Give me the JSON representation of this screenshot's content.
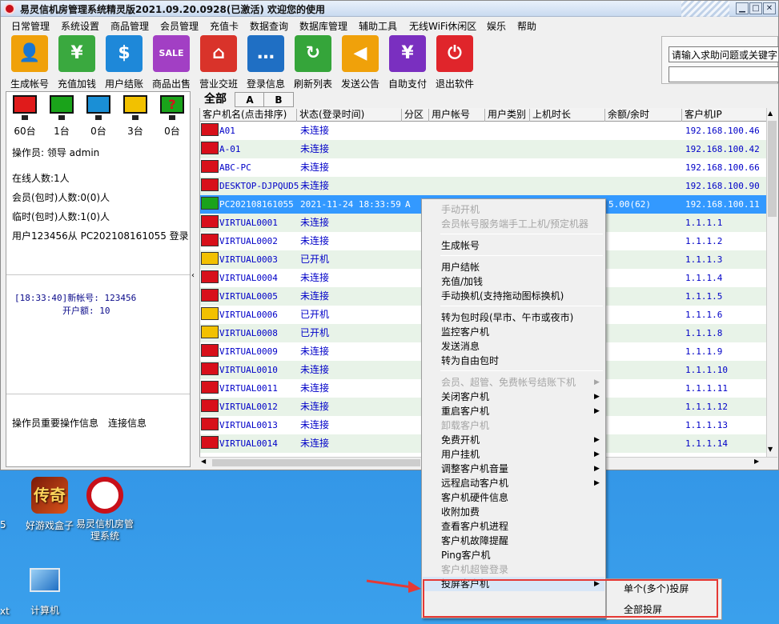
{
  "window": {
    "title": "易灵信机房管理系统精灵版2021.09.20.0928(已激活)   欢迎您的使用"
  },
  "menubar": [
    "日常管理",
    "系统设置",
    "商品管理",
    "会员管理",
    "充值卡",
    "数据查询",
    "数据库管理",
    "辅助工具",
    "无线WiFi休闲区",
    "娱乐",
    "帮助"
  ],
  "toolbar": [
    {
      "label": "生成帐号",
      "icon": "user-icon",
      "color": "#f0a10a",
      "glyph": "👤"
    },
    {
      "label": "充值加钱",
      "icon": "piggy-bank-icon",
      "color": "#3aa93f",
      "glyph": "¥"
    },
    {
      "label": "用户结账",
      "icon": "bill-icon",
      "color": "#1e88d9",
      "glyph": "$"
    },
    {
      "label": "商品出售",
      "icon": "sale-tag-icon",
      "color": "#a23fc4",
      "glyph": "SALE"
    },
    {
      "label": "营业交班",
      "icon": "shop-icon",
      "color": "#d9332a",
      "glyph": "⌂"
    },
    {
      "label": "登录信息",
      "icon": "chat-icon",
      "color": "#1f6fc4",
      "glyph": "…"
    },
    {
      "label": "刷新列表",
      "icon": "refresh-icon",
      "color": "#35a53a",
      "glyph": "↻"
    },
    {
      "label": "发送公告",
      "icon": "megaphone-icon",
      "color": "#f0a10a",
      "glyph": "◀"
    },
    {
      "label": "自助支付",
      "icon": "payment-icon",
      "color": "#7a2fc0",
      "glyph": "¥"
    },
    {
      "label": "退出软件",
      "icon": "power-icon",
      "color": "#e0252b",
      "glyph": "⏻"
    }
  ],
  "help_search": {
    "placeholder": "请输入求助问题或关键字"
  },
  "status_counts": [
    {
      "count": "60台",
      "color": "#e01b1b",
      "icon": "monitor-red-icon"
    },
    {
      "count": "1台",
      "color": "#1aa31a",
      "icon": "monitor-green-icon"
    },
    {
      "count": "0台",
      "color": "#1a8fd6",
      "icon": "monitor-blue-icon"
    },
    {
      "count": "3台",
      "color": "#f2c100",
      "icon": "monitor-yellow-icon"
    },
    {
      "count": "0台",
      "color": "#1aa31a",
      "icon": "monitor-unknown-icon"
    }
  ],
  "left_info": {
    "operator": "操作员:  领导 admin",
    "online": "在线人数:1人",
    "member": "会员(包时)人数:0(0)人",
    "temp": "临时(包时)人数:1(0)人",
    "login": "用户123456从 PC202108161055 登录",
    "log_line1": "[18:33:40]新帐号: 123456",
    "log_line2": "开户额: 10",
    "bottom_tab1": "操作员重要操作信息",
    "bottom_tab2": "连接信息"
  },
  "tabs": [
    "全部",
    "A",
    "B"
  ],
  "grid": {
    "columns": [
      "客户机名(点击排序)",
      "状态(登录时间)",
      "分区",
      "用户帐号",
      "用户类别",
      "上机时长",
      "余额/余时",
      "客户机IP"
    ],
    "rows": [
      {
        "name": "A01",
        "status": "未连接",
        "zone": "",
        "account": "",
        "type": "",
        "duration": "",
        "balance": "",
        "ip": "192.168.100.46",
        "color": "#d8101a"
      },
      {
        "name": "A-01",
        "status": "未连接",
        "zone": "",
        "account": "",
        "type": "",
        "duration": "",
        "balance": "",
        "ip": "192.168.100.42",
        "color": "#d8101a"
      },
      {
        "name": "ABC-PC",
        "status": "未连接",
        "zone": "",
        "account": "",
        "type": "",
        "duration": "",
        "balance": "",
        "ip": "192.168.100.66",
        "color": "#d8101a"
      },
      {
        "name": "DESKTOP-DJPQUD5",
        "status": "未连接",
        "zone": "",
        "account": "",
        "type": "",
        "duration": "",
        "balance": "",
        "ip": "192.168.100.90",
        "color": "#d8101a"
      },
      {
        "name": "PC202108161055",
        "status": "2021-11-24 18:33:59",
        "zone": "A",
        "account": "",
        "type": "",
        "duration": "",
        "balance": "5.00(62)",
        "ip": "192.168.100.11",
        "color": "#1aa31a",
        "selected": true
      },
      {
        "name": "VIRTUAL0001",
        "status": "未连接",
        "zone": "",
        "account": "",
        "type": "",
        "duration": "",
        "balance": "",
        "ip": "1.1.1.1",
        "color": "#d8101a"
      },
      {
        "name": "VIRTUAL0002",
        "status": "未连接",
        "zone": "",
        "account": "",
        "type": "",
        "duration": "",
        "balance": "",
        "ip": "1.1.1.2",
        "color": "#d8101a"
      },
      {
        "name": "VIRTUAL0003",
        "status": "已开机",
        "zone": "",
        "account": "",
        "type": "",
        "duration": "",
        "balance": "",
        "ip": "1.1.1.3",
        "color": "#f2c100"
      },
      {
        "name": "VIRTUAL0004",
        "status": "未连接",
        "zone": "",
        "account": "",
        "type": "",
        "duration": "",
        "balance": "",
        "ip": "1.1.1.4",
        "color": "#d8101a"
      },
      {
        "name": "VIRTUAL0005",
        "status": "未连接",
        "zone": "",
        "account": "",
        "type": "",
        "duration": "",
        "balance": "",
        "ip": "1.1.1.5",
        "color": "#d8101a"
      },
      {
        "name": "VIRTUAL0006",
        "status": "已开机",
        "zone": "",
        "account": "",
        "type": "",
        "duration": "",
        "balance": "",
        "ip": "1.1.1.6",
        "color": "#f2c100"
      },
      {
        "name": "VIRTUAL0008",
        "status": "已开机",
        "zone": "",
        "account": "",
        "type": "",
        "duration": "",
        "balance": "",
        "ip": "1.1.1.8",
        "color": "#f2c100"
      },
      {
        "name": "VIRTUAL0009",
        "status": "未连接",
        "zone": "",
        "account": "",
        "type": "",
        "duration": "",
        "balance": "",
        "ip": "1.1.1.9",
        "color": "#d8101a"
      },
      {
        "name": "VIRTUAL0010",
        "status": "未连接",
        "zone": "",
        "account": "",
        "type": "",
        "duration": "",
        "balance": "",
        "ip": "1.1.1.10",
        "color": "#d8101a"
      },
      {
        "name": "VIRTUAL0011",
        "status": "未连接",
        "zone": "",
        "account": "",
        "type": "",
        "duration": "",
        "balance": "",
        "ip": "1.1.1.11",
        "color": "#d8101a"
      },
      {
        "name": "VIRTUAL0012",
        "status": "未连接",
        "zone": "",
        "account": "",
        "type": "",
        "duration": "",
        "balance": "",
        "ip": "1.1.1.12",
        "color": "#d8101a"
      },
      {
        "name": "VIRTUAL0013",
        "status": "未连接",
        "zone": "",
        "account": "",
        "type": "",
        "duration": "",
        "balance": "",
        "ip": "1.1.1.13",
        "color": "#d8101a"
      },
      {
        "name": "VIRTUAL0014",
        "status": "未连接",
        "zone": "",
        "account": "",
        "type": "",
        "duration": "",
        "balance": "",
        "ip": "1.1.1.14",
        "color": "#d8101a"
      }
    ]
  },
  "context_menu": [
    {
      "label": "手动开机",
      "disabled": true
    },
    {
      "label": "会员帐号服务端手工上机/预定机器",
      "disabled": true
    },
    {
      "sep": true
    },
    {
      "label": "生成帐号"
    },
    {
      "sep": true
    },
    {
      "label": "用户结帐"
    },
    {
      "label": "充值/加钱"
    },
    {
      "label": "手动换机(支持拖动图标换机)"
    },
    {
      "sep": true
    },
    {
      "label": "转为包时段(早市、午市或夜市)"
    },
    {
      "label": "监控客户机"
    },
    {
      "label": "发送消息"
    },
    {
      "label": "转为自由包时"
    },
    {
      "sep": true
    },
    {
      "label": "会员、超管、免费帐号结账下机",
      "disabled": true,
      "submenu": true
    },
    {
      "label": "关闭客户机",
      "submenu": true
    },
    {
      "label": "重启客户机",
      "submenu": true
    },
    {
      "label": "卸载客户机",
      "disabled": true
    },
    {
      "label": "免费开机",
      "submenu": true
    },
    {
      "label": "用户挂机",
      "submenu": true
    },
    {
      "label": "调整客户机音量",
      "submenu": true
    },
    {
      "label": "远程启动客户机",
      "submenu": true
    },
    {
      "label": "客户机硬件信息"
    },
    {
      "label": "收附加费"
    },
    {
      "label": "查看客户机进程"
    },
    {
      "label": "客户机故障提醒"
    },
    {
      "label": "Ping客户机"
    },
    {
      "label": "客户机超管登录",
      "disabled": true
    },
    {
      "label": "投屏客户机",
      "submenu": true,
      "highlight": true
    }
  ],
  "submenu": [
    "单个(多个)投屏",
    "全部投屏"
  ],
  "desktop": [
    {
      "label": "好游戏盒子",
      "icon": "game-box-icon"
    },
    {
      "label": "易灵信机房管理系统",
      "icon": "app-shortcut-icon"
    },
    {
      "label": "计算机",
      "icon": "computer-icon"
    }
  ],
  "desktop_partial": [
    "5",
    "xt"
  ]
}
